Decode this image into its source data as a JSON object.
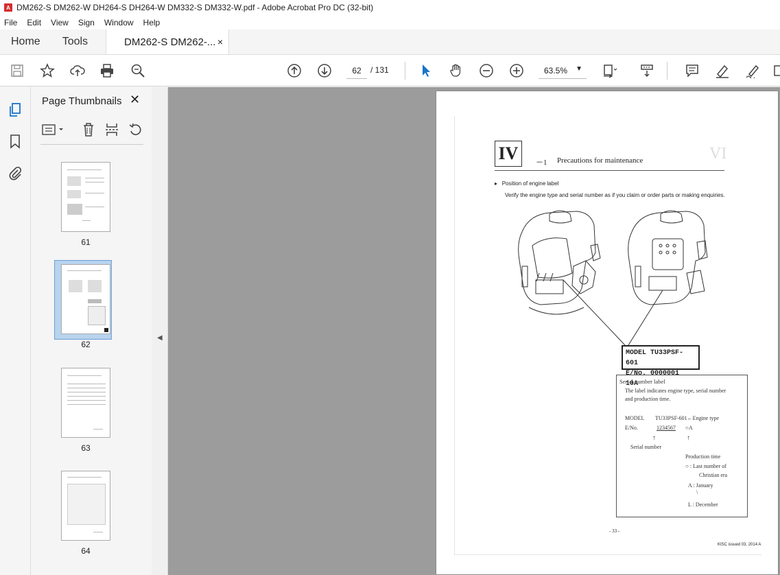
{
  "window": {
    "title": "DM262-S DM262-W DH264-S DH264-W DM332-S DM332-W.pdf - Adobe Acrobat Pro DC (32-bit)"
  },
  "menu": [
    "File",
    "Edit",
    "View",
    "Sign",
    "Window",
    "Help"
  ],
  "tabs": {
    "home": "Home",
    "tools": "Tools",
    "document": "DM262-S DM262-...",
    "close": "×"
  },
  "toolbar": {
    "page_current": "62",
    "page_total": "/ 131",
    "zoom": "63.5%"
  },
  "thumbnails": {
    "title": "Page Thumbnails",
    "close": "✕",
    "pages": [
      {
        "label": "61",
        "selected": false
      },
      {
        "label": "62",
        "selected": true
      },
      {
        "label": "63",
        "selected": false
      },
      {
        "label": "64",
        "selected": false
      }
    ]
  },
  "pdf_page": {
    "chapter_numeral": "IV",
    "chapter_dash": "－1",
    "chapter_title": "Precautions for maintenance",
    "chapter_ghost": "VI",
    "section_heading": "Position of engine label",
    "section_description": "Verify the engine type and serial number as if you claim or order parts or making enquiries.",
    "plate_line1": "MODEL  TU33PSF-601",
    "plate_line2": "E/No.  0000001 10A",
    "serial_box": {
      "title": "Serial number label",
      "desc1": "The label indicates engine type, serial number",
      "desc2": "and production time.",
      "model_label": "MODEL",
      "model_value": "TU33PSF-601←Engine type",
      "eno_label": "E/No.",
      "eno_value": "1234567",
      "eno_suffix": "○A",
      "serial_caption": "Serial number",
      "production_time": "Production time",
      "circle_meaning": "○   : Last number of",
      "circle_meaning2": "Christian era",
      "a_meaning": "A :  January",
      "tilde": "\\",
      "l_meaning": "L :  December"
    },
    "page_number": "- 33 -",
    "footer": "KISC issued 03, 2014 A"
  }
}
